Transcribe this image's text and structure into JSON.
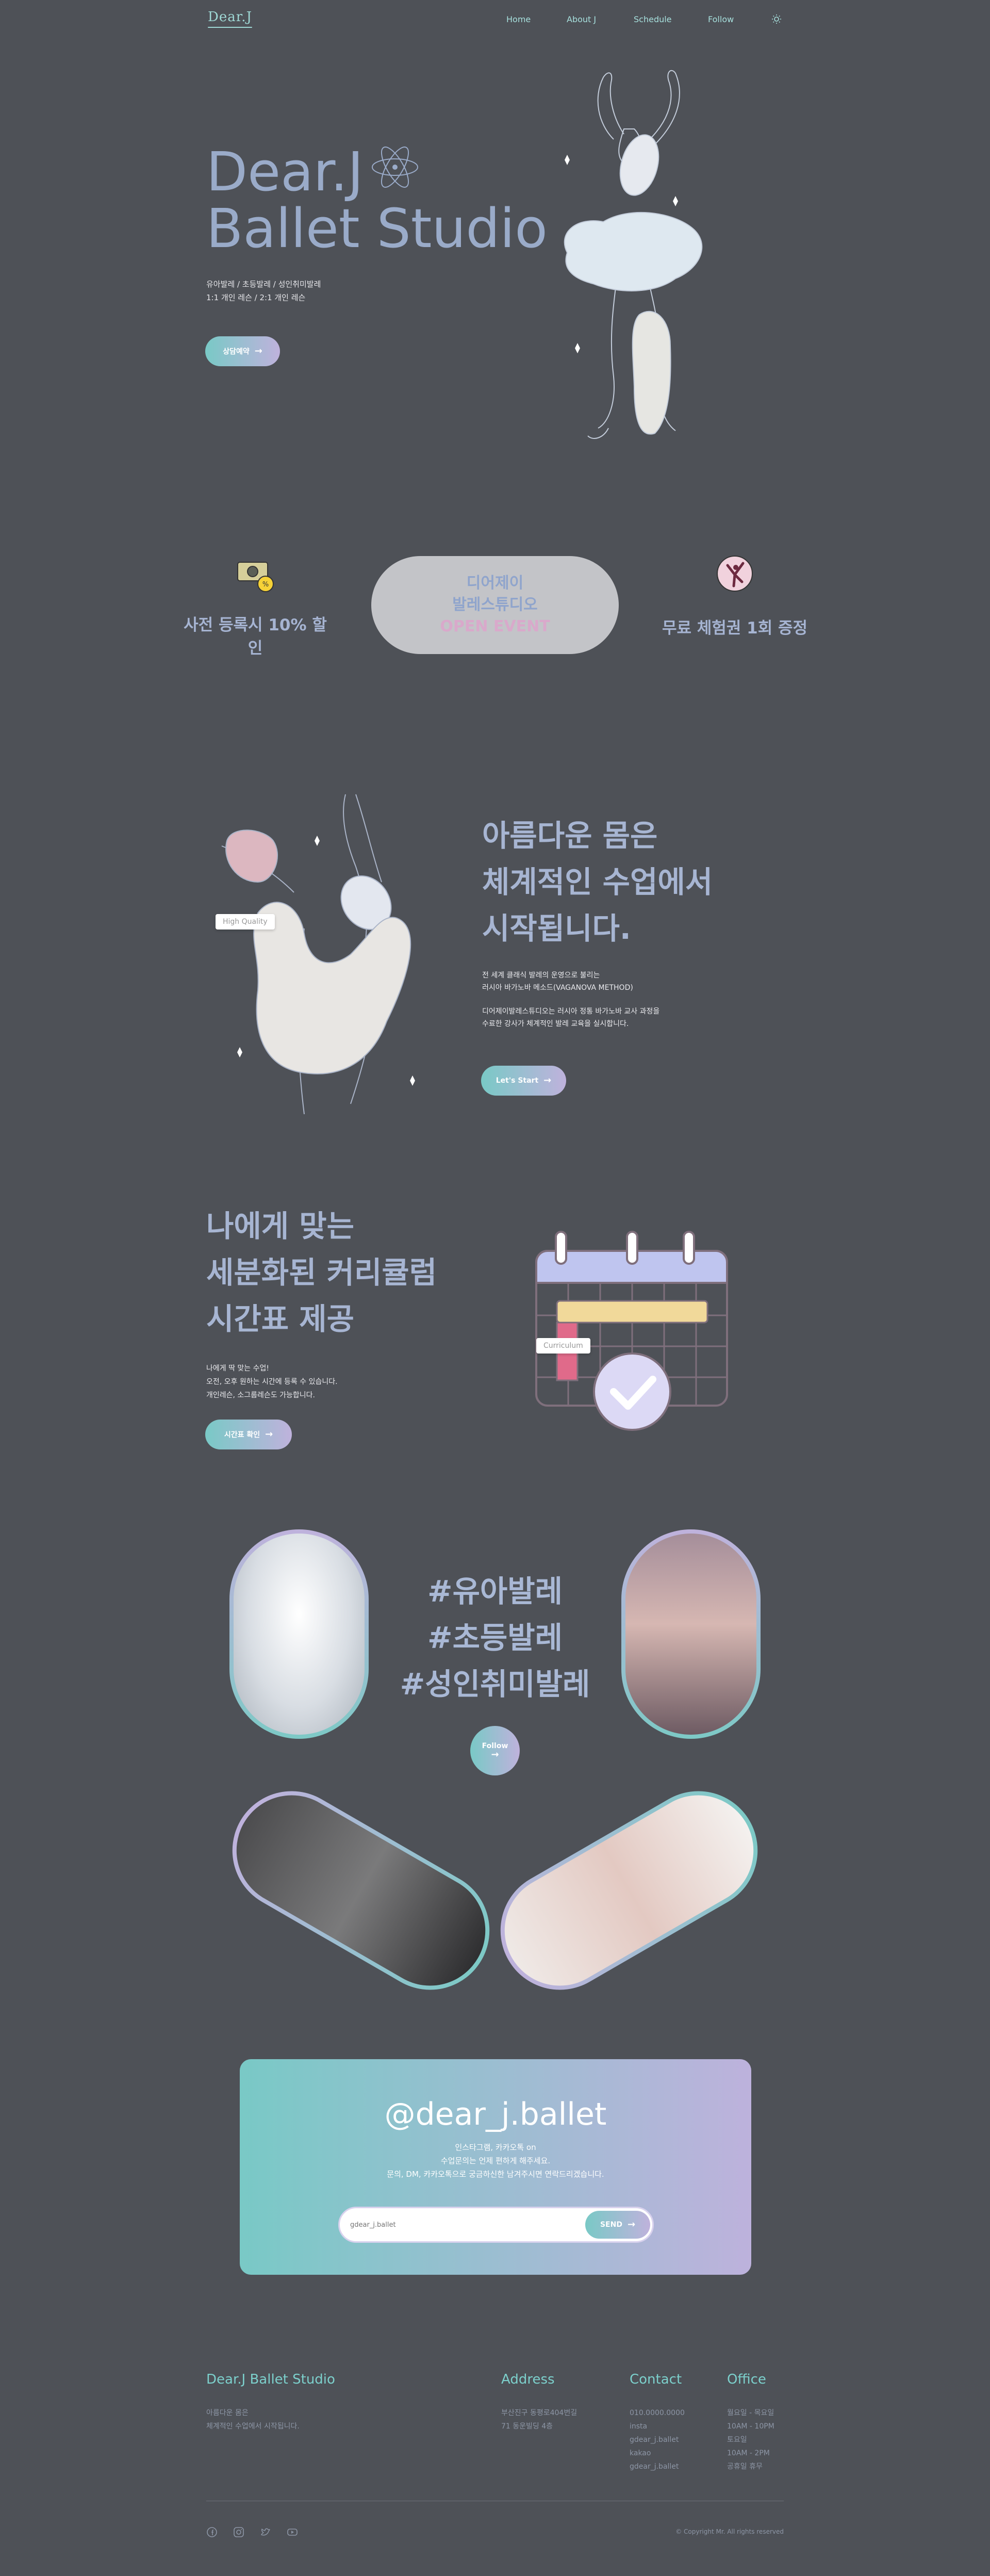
{
  "header": {
    "logo": "Dear.J",
    "nav": [
      "Home",
      "About J",
      "Schedule",
      "Follow"
    ],
    "theme_icon": "sun-icon"
  },
  "hero": {
    "title_line1": "Dear.J",
    "title_line2": "Ballet Studio",
    "sub_line1": "유아발레 / 초등발레 / 성인취미발레",
    "sub_line2": "1:1 개인 레슨 / 2:1 개인 레슨",
    "cta": "상담예약"
  },
  "events": {
    "left_label": "사전 등록시 10% 할인",
    "pill_line1": "디어제이",
    "pill_line2": "발레스튜디오",
    "pill_line3": "OPEN EVENT",
    "right_label": "무료 체험권 1회 증정"
  },
  "intro": {
    "title": [
      "아름다운 몸은",
      "체계적인 수업에서",
      "시작됩니다."
    ],
    "p1": [
      "전 세계 클래식 발레의 운영으로 불리는",
      "러시아 바가노바 메소드(VAGANOVA METHOD)"
    ],
    "p2": [
      "디어제이발레스튜디오는 러시아 정통 바가노바 교사 과정을",
      "수료한 강사가 체계적인 발레 교육을 실시합니다."
    ],
    "tag": "High Quality",
    "cta": "Let's Start"
  },
  "curriculum": {
    "title": [
      "나에게 맞는",
      "세분화된 커리큘럼",
      "시간표 제공"
    ],
    "p": [
      "나에게 딱 맞는 수업!",
      "오전, 오후 원하는 시간에 등록 수 있습니다.",
      "개인레슨, 소그룹레슨도 가능합니다."
    ],
    "tag": "Curriculum",
    "cta": "시간표 확인"
  },
  "programs": {
    "hashtags": [
      "#유아발레",
      "#초등발레",
      "#성인취미발레"
    ],
    "follow": "Follow"
  },
  "instagram": {
    "handle": "@dear_j.ballet",
    "p": [
      "인스타그램, 카카오톡 on",
      "수업문의는 언제 편하게 해주세요.",
      "문의, DM, 카카오톡으로 궁금하신한 남겨주시면 연락드리겠습니다."
    ],
    "placeholder": "gdear_j.ballet",
    "send": "SEND"
  },
  "footer": {
    "brand": "Dear.J Ballet Studio",
    "brand_p": [
      "아름다운 몸은",
      "체계적인 수업에서 시작됩니다."
    ],
    "address_h": "Address",
    "address": [
      "부산진구 동평로404번길",
      "71 동운빌딩 4층"
    ],
    "contact_h": "Contact",
    "contact": [
      "010.0000.0000",
      "insta",
      "gdear_j.ballet",
      "kakao",
      "gdear_j.ballet"
    ],
    "office_h": "Office",
    "office": [
      "월요일 - 목요일",
      "10AM - 10PM",
      "토요일",
      "10AM - 2PM",
      "공휴일 휴무"
    ],
    "copyright": "© Copyright Mr. All rights reserved"
  }
}
